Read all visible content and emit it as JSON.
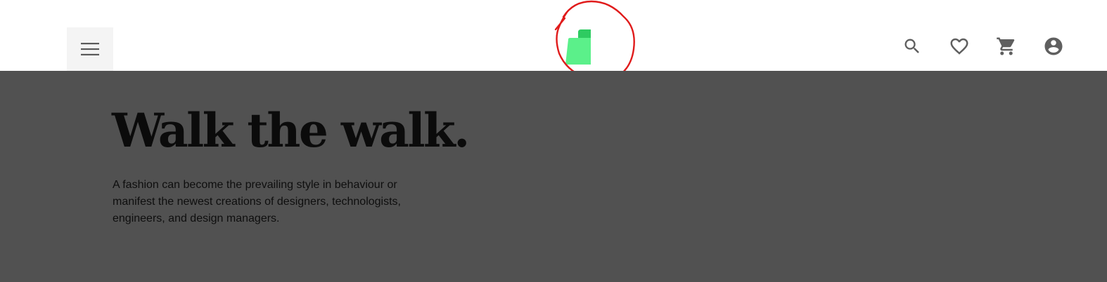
{
  "header": {
    "menu_icon": "hamburger-menu-icon",
    "logo": {
      "icon": "shopping-bag-logo-icon",
      "colors": {
        "front": "#5bf08a",
        "back": "#2ecb61",
        "annotation": "#e01b1b"
      }
    },
    "actions": [
      {
        "icon": "search-icon"
      },
      {
        "icon": "heart-icon"
      },
      {
        "icon": "cart-icon"
      },
      {
        "icon": "account-circle-icon"
      }
    ]
  },
  "hero": {
    "title": "Walk the walk.",
    "description": "A fashion can become the prevailing style in behaviour or manifest the newest creations of designers, technologists, engineers, and design managers.",
    "background_color": "#515151"
  }
}
